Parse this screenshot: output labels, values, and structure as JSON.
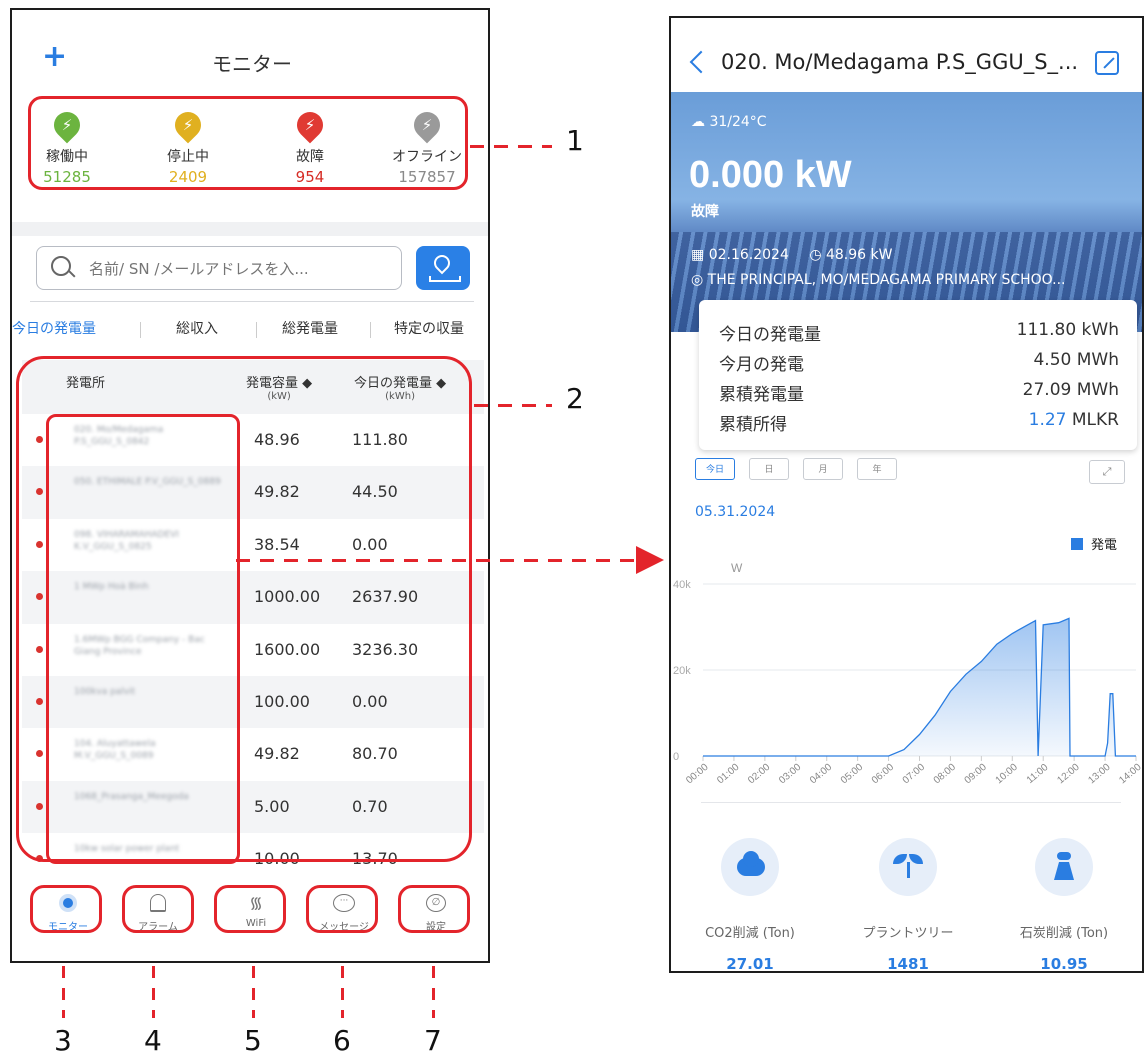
{
  "monitor": {
    "add_label": "+",
    "title": "モニター",
    "stats": [
      {
        "label": "稼働中",
        "value": "51285",
        "color": "#6cb43f",
        "icon": "bolt-icon"
      },
      {
        "label": "停止中",
        "value": "2409",
        "color": "#e0b020",
        "icon": "bolt-icon"
      },
      {
        "label": "故障",
        "value": "954",
        "color": "#e03a33",
        "icon": "bolt-icon"
      },
      {
        "label": "オフライン",
        "value": "157857",
        "color": "#9a9a9a",
        "icon": "bolt-icon"
      }
    ],
    "search_placeholder": "名前/ SN /メールアドレスを入...",
    "tabs": [
      "今日の発電量",
      "総収入",
      "総発電量",
      "特定の収量"
    ],
    "table": {
      "headers": {
        "station": "発電所",
        "capacity": "発電容量 ◆",
        "capacity_unit": "(kW)",
        "today": "今日の発電量 ◆",
        "today_unit": "(kWh)"
      },
      "rows": [
        {
          "name": "020. Mo/Medagama P.S_GGU_S_0842",
          "capacity": "48.96",
          "today": "111.80"
        },
        {
          "name": "050. ETHIMALE P.V_GGU_S_0889",
          "capacity": "49.82",
          "today": "44.50"
        },
        {
          "name": "098. VIHARAMAHADEVI K.V_GGU_S_0825",
          "capacity": "38.54",
          "today": "0.00"
        },
        {
          "name": "1 MWp Hoà Bình",
          "capacity": "1000.00",
          "today": "2637.90"
        },
        {
          "name": "1.6MWp BGG Company - Bac Giang Province",
          "capacity": "1600.00",
          "today": "3236.30"
        },
        {
          "name": "100kva palvit",
          "capacity": "100.00",
          "today": "0.00"
        },
        {
          "name": "104. Aluyattawela M.V_GGU_S_0089",
          "capacity": "49.82",
          "today": "80.70"
        },
        {
          "name": "1068_Prasanga_Meegoda",
          "capacity": "5.00",
          "today": "0.70"
        },
        {
          "name": "10kw solar power plant",
          "capacity": "10.00",
          "today": "13.70"
        }
      ]
    },
    "nav": [
      {
        "label": "モニター",
        "icon": "monitor-icon",
        "active": true
      },
      {
        "label": "アラーム",
        "icon": "bell-icon",
        "active": false
      },
      {
        "label": "WiFi",
        "icon": "wifi-icon",
        "active": false
      },
      {
        "label": "メッセージ",
        "icon": "message-icon",
        "active": false
      },
      {
        "label": "設定",
        "icon": "settings-icon",
        "active": false
      }
    ]
  },
  "callouts": {
    "n1": "1",
    "n2": "2",
    "n3": "3",
    "n4": "4",
    "n5": "5",
    "n6": "6",
    "n7": "7",
    "color": "#e3242b"
  },
  "detail": {
    "title": "020. Mo/Medagama P.S_GGU_S_...",
    "weather": "31/24°C",
    "power": "0.000 kW",
    "status": "故障",
    "date_meta": "02.16.2024",
    "capacity_meta": "48.96 kW",
    "address": "THE PRINCIPAL, MO/MEDAGAMA PRIMARY SCHOO...",
    "summary": [
      {
        "label": "今日の発電量",
        "value": "111.80 kWh"
      },
      {
        "label": "今月の発電",
        "value": "4.50 MWh"
      },
      {
        "label": "累積発電量",
        "value": "27.09 MWh"
      },
      {
        "label": "累積所得",
        "value_highlight": "1.27",
        "value_unit": " MLKR"
      }
    ],
    "periods": [
      "今日",
      "日",
      "月",
      "年"
    ],
    "chart_date": "05.31.2024",
    "bottom": [
      {
        "label": "CO2削減 (Ton)",
        "value": "27.01",
        "icon": "co2-cloud-icon"
      },
      {
        "label": "プラントツリー",
        "value": "1481",
        "icon": "sprout-icon"
      },
      {
        "label": "石炭削減 (Ton)",
        "value": "10.95",
        "icon": "factory-icon"
      }
    ]
  },
  "chart_data": {
    "type": "area",
    "title": "",
    "ylabel": "W",
    "legend": [
      "発電"
    ],
    "legend_position": "top-right",
    "ylim": [
      0,
      40000
    ],
    "yticks": [
      "0",
      "20k",
      "40k"
    ],
    "xticks": [
      "00:00",
      "01:00",
      "02:00",
      "03:00",
      "04:00",
      "05:00",
      "06:00",
      "07:00",
      "08:00",
      "09:00",
      "10:00",
      "11:00",
      "12:00",
      "13:00",
      "14:00"
    ],
    "series": [
      {
        "name": "発電",
        "color": "#2a7de1",
        "x": [
          "00:00",
          "06:00",
          "06:30",
          "07:00",
          "07:30",
          "08:00",
          "08:30",
          "09:00",
          "09:30",
          "10:00",
          "10:30",
          "10:45",
          "10:50",
          "11:00",
          "11:30",
          "11:50",
          "11:52",
          "12:00",
          "13:00",
          "13:05",
          "13:10",
          "13:15",
          "13:20",
          "14:00"
        ],
        "y": [
          0,
          0,
          1500,
          5000,
          9500,
          15000,
          19000,
          22000,
          26000,
          28500,
          30500,
          31500,
          0,
          30500,
          31000,
          32000,
          0,
          0,
          0,
          3000,
          14500,
          14500,
          0,
          0
        ]
      }
    ]
  }
}
